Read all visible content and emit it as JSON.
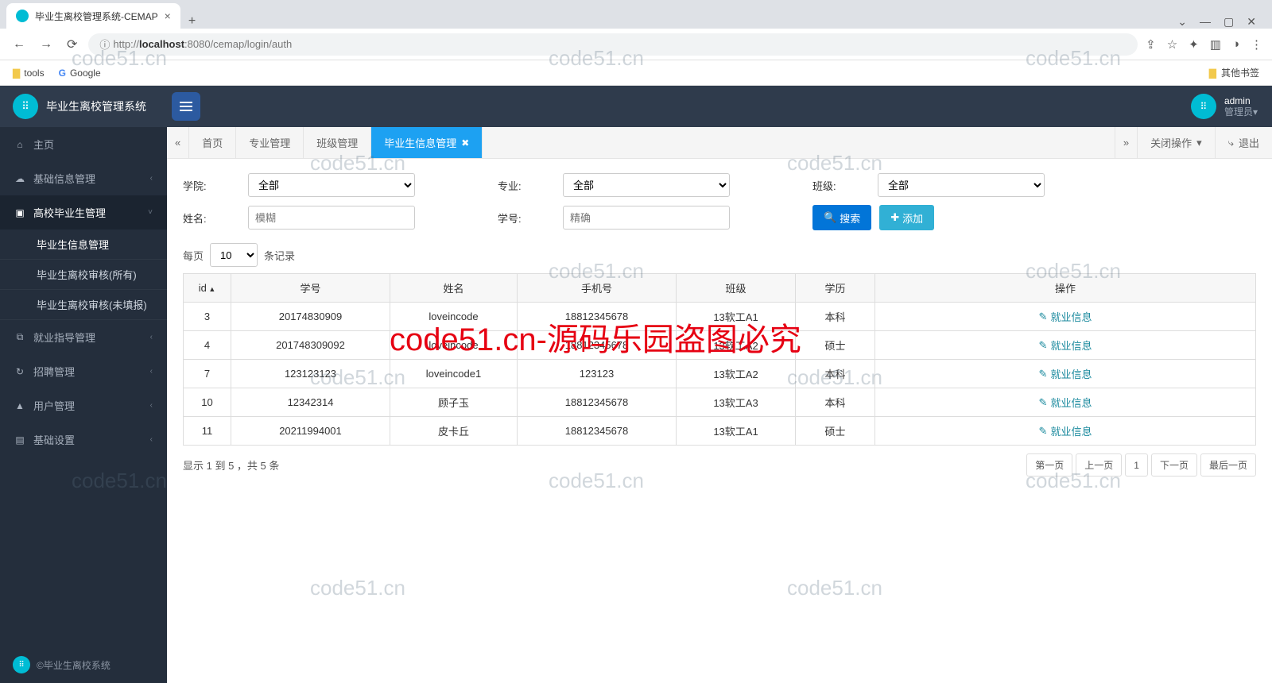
{
  "browser": {
    "tab_title": "毕业生离校管理系统-CEMAP",
    "url_display": "http://localhost:8080/cemap/login/auth",
    "url_host": "localhost",
    "bookmarks": {
      "tools": "tools",
      "google": "Google",
      "other": "其他书签"
    }
  },
  "header": {
    "app_name": "毕业生离校管理系统",
    "user_name": "admin",
    "user_role": "管理员"
  },
  "sidebar": {
    "items": [
      {
        "icon": "⌂",
        "label": "主页"
      },
      {
        "icon": "☁",
        "label": "基础信息管理",
        "chev": "‹"
      },
      {
        "icon": "▣",
        "label": "高校毕业生管理",
        "chev": "˅",
        "active": true
      },
      {
        "icon": "⧉",
        "label": "就业指导管理",
        "chev": "‹"
      },
      {
        "icon": "↻",
        "label": "招聘管理",
        "chev": "‹"
      },
      {
        "icon": "▲",
        "label": "用户管理",
        "chev": "‹"
      },
      {
        "icon": "▤",
        "label": "基础设置",
        "chev": "‹"
      }
    ],
    "sub": [
      "毕业生信息管理",
      "毕业生离校审核(所有)",
      "毕业生离校审核(未填报)"
    ],
    "footer": "©毕业生离校系统"
  },
  "tabs": {
    "scroll_left": "«",
    "items": [
      "首页",
      "专业管理",
      "班级管理"
    ],
    "active": "毕业生信息管理",
    "scroll_right": "»",
    "close_ops": "关闭操作",
    "logout": "退出"
  },
  "filters": {
    "college_label": "学院:",
    "college_value": "全部",
    "major_label": "专业:",
    "major_value": "全部",
    "class_label": "班级:",
    "class_value": "全部",
    "name_label": "姓名:",
    "name_placeholder": "模糊",
    "sno_label": "学号:",
    "sno_placeholder": "精确",
    "search_btn": "搜索",
    "add_btn": "添加"
  },
  "paging": {
    "per_prefix": "每页",
    "per_value": "10",
    "per_suffix": "条记录",
    "summary": "显示 1 到 5 ，共 5 条",
    "first": "第一页",
    "prev": "上一页",
    "page": "1",
    "next": "下一页",
    "last": "最后一页"
  },
  "table": {
    "headers": [
      "id",
      "学号",
      "姓名",
      "手机号",
      "班级",
      "学历",
      "操作"
    ],
    "op_label": "就业信息",
    "rows": [
      {
        "id": "3",
        "sno": "20174830909",
        "name": "loveincode",
        "phone": "18812345678",
        "class": "13软工A1",
        "edu": "本科"
      },
      {
        "id": "4",
        "sno": "201748309092",
        "name": "loveincode",
        "phone": "18812345678",
        "class": "13软工A2",
        "edu": "硕士"
      },
      {
        "id": "7",
        "sno": "123123123",
        "name": "loveincode1",
        "phone": "123123",
        "class": "13软工A2",
        "edu": "本科"
      },
      {
        "id": "10",
        "sno": "12342314",
        "name": "顾子玉",
        "phone": "18812345678",
        "class": "13软工A3",
        "edu": "本科"
      },
      {
        "id": "11",
        "sno": "20211994001",
        "name": "皮卡丘",
        "phone": "18812345678",
        "class": "13软工A1",
        "edu": "硕士"
      }
    ]
  },
  "watermark": {
    "light": "code51.cn",
    "red": "code51.cn-源码乐园盗图必究"
  }
}
